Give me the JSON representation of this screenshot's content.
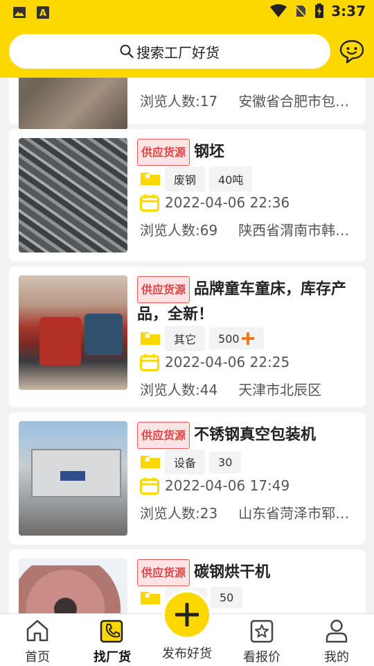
{
  "status": {
    "time": "3:37"
  },
  "header": {
    "search_placeholder": "搜索工厂好货"
  },
  "items": [
    {
      "views": "浏览人数:17",
      "location": "安徽省合肥市包…"
    },
    {
      "tag": "供应货源",
      "title": "钢坯",
      "category": "废钢",
      "quantity": "40吨",
      "date": "2022-04-06 22:36",
      "views": "浏览人数:69",
      "location": "陕西省渭南市韩…"
    },
    {
      "tag": "供应货源",
      "title": "品牌童车童床，库存产品，全新！",
      "category": "其它",
      "quantity": "500",
      "date": "2022-04-06 22:25",
      "views": "浏览人数:44",
      "location": "天津市北辰区"
    },
    {
      "tag": "供应货源",
      "title": "不锈钢真空包装机",
      "category": "设备",
      "quantity": "30",
      "date": "2022-04-06 17:49",
      "views": "浏览人数:23",
      "location": "山东省菏泽市郓…"
    },
    {
      "tag": "供应货源",
      "title": "碳钢烘干机",
      "quantity": "50"
    }
  ],
  "tabbar": {
    "home": "首页",
    "find": "找厂货",
    "publish": "发布好货",
    "quotes": "看报价",
    "mine": "我的"
  },
  "colors": {
    "brand": "#fdd700",
    "tag_red": "#e04545",
    "plus_orange": "#f07a1a"
  }
}
